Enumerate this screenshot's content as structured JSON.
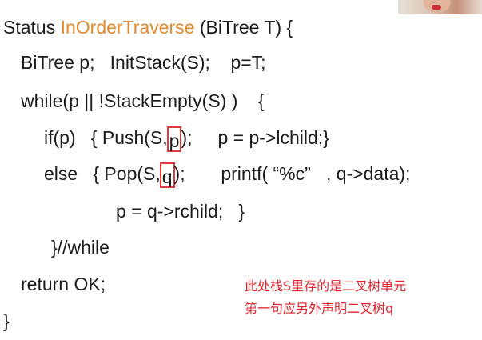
{
  "code": {
    "line1": {
      "prefix": "Status ",
      "function_name": "InOrderTraverse",
      "suffix": " (BiTree T) {"
    },
    "line2": "BiTree p;   InitStack(S);    p=T;",
    "line3": "while(p || !StackEmpty(S) )    {",
    "line4": {
      "before": "if(p)   { Push(S,",
      "boxed": "p",
      "after": ");     p = p->lchild;}"
    },
    "line5": {
      "before": "else   { Pop(S,",
      "boxed": "q",
      "after": ");       printf( “%c”   , q->data);"
    },
    "line6": "p = q->rchild;   }",
    "line7": "}//while",
    "line8": "return OK;",
    "line9": "}"
  },
  "annotation": {
    "line1": "此处栈S里存的是二叉树单元",
    "line2": "第一句应另外声明二叉树q"
  },
  "colors": {
    "text": "#1b1b1b",
    "function_name": "#e3892f",
    "highlight_box": "#e03a3a",
    "annotation": "#e8202a"
  }
}
